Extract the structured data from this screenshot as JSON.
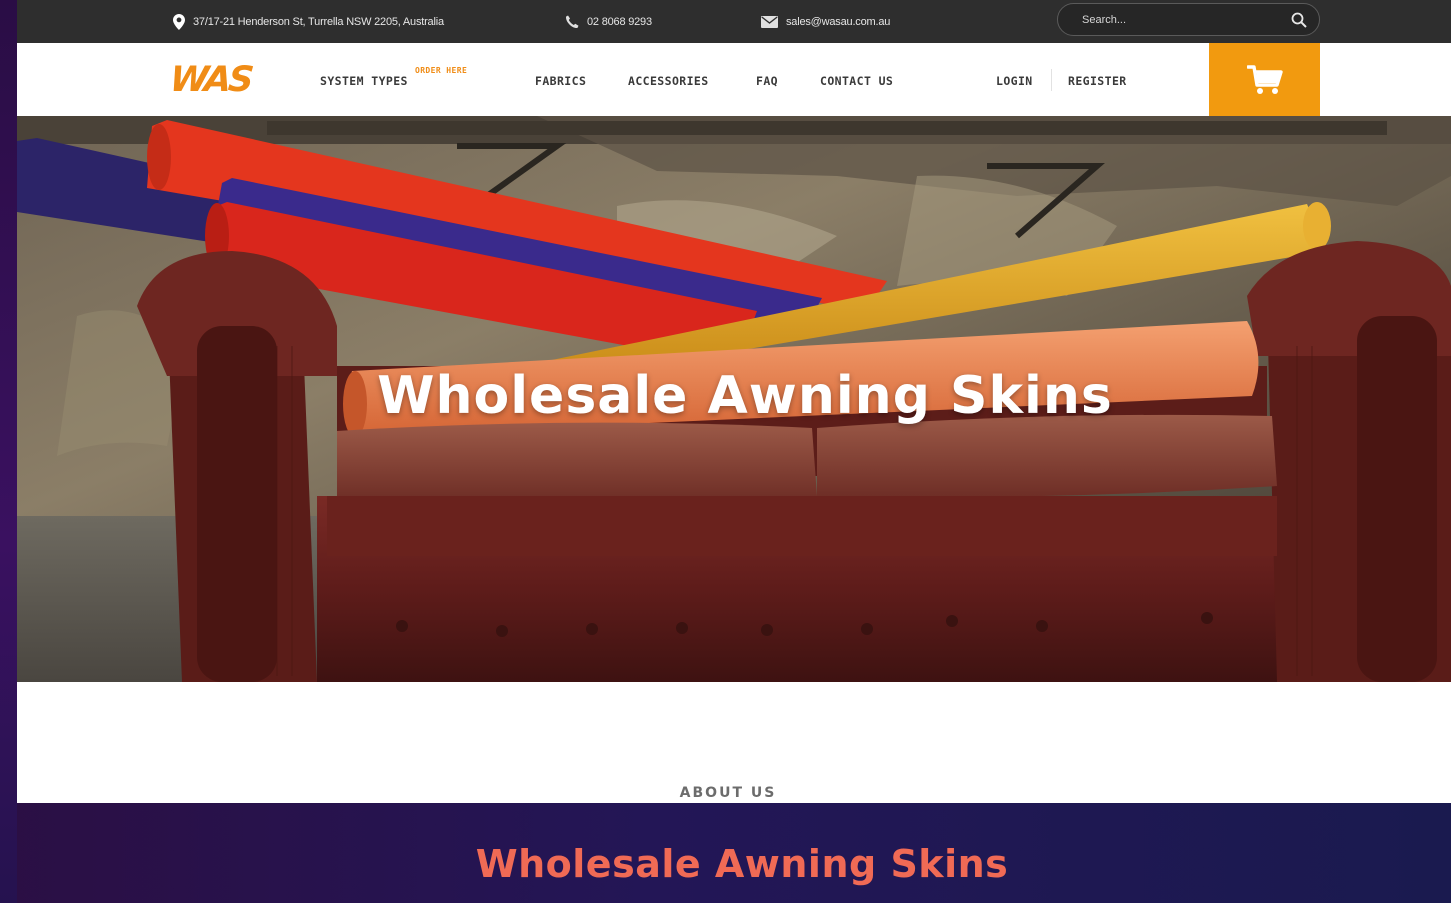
{
  "topbar": {
    "address": "37/17-21 Henderson St, Turrella NSW 2205, Australia",
    "phone": "02 8068 9293",
    "email": "sales@wasau.com.au",
    "search_placeholder": "Search..."
  },
  "nav": {
    "logo": "WAS",
    "items": [
      {
        "label": "SYSTEM TYPES"
      },
      {
        "label": "FABRICS"
      },
      {
        "label": "ACCESSORIES"
      },
      {
        "label": "FAQ"
      },
      {
        "label": "CONTACT US"
      }
    ],
    "order_badge": "ORDER HERE",
    "login": "LOGIN",
    "register": "REGISTER"
  },
  "hero": {
    "title": "Wholesale Awning Skins"
  },
  "about": {
    "label": "ABOUT US",
    "title": "Wholesale Awning Skins"
  },
  "colors": {
    "accent": "#f29a0f",
    "topbar_bg": "#2e2e2e",
    "section_title": "#f06a55"
  },
  "icons": [
    "map-pin-icon",
    "phone-icon",
    "email-icon",
    "search-icon",
    "cart-icon"
  ]
}
